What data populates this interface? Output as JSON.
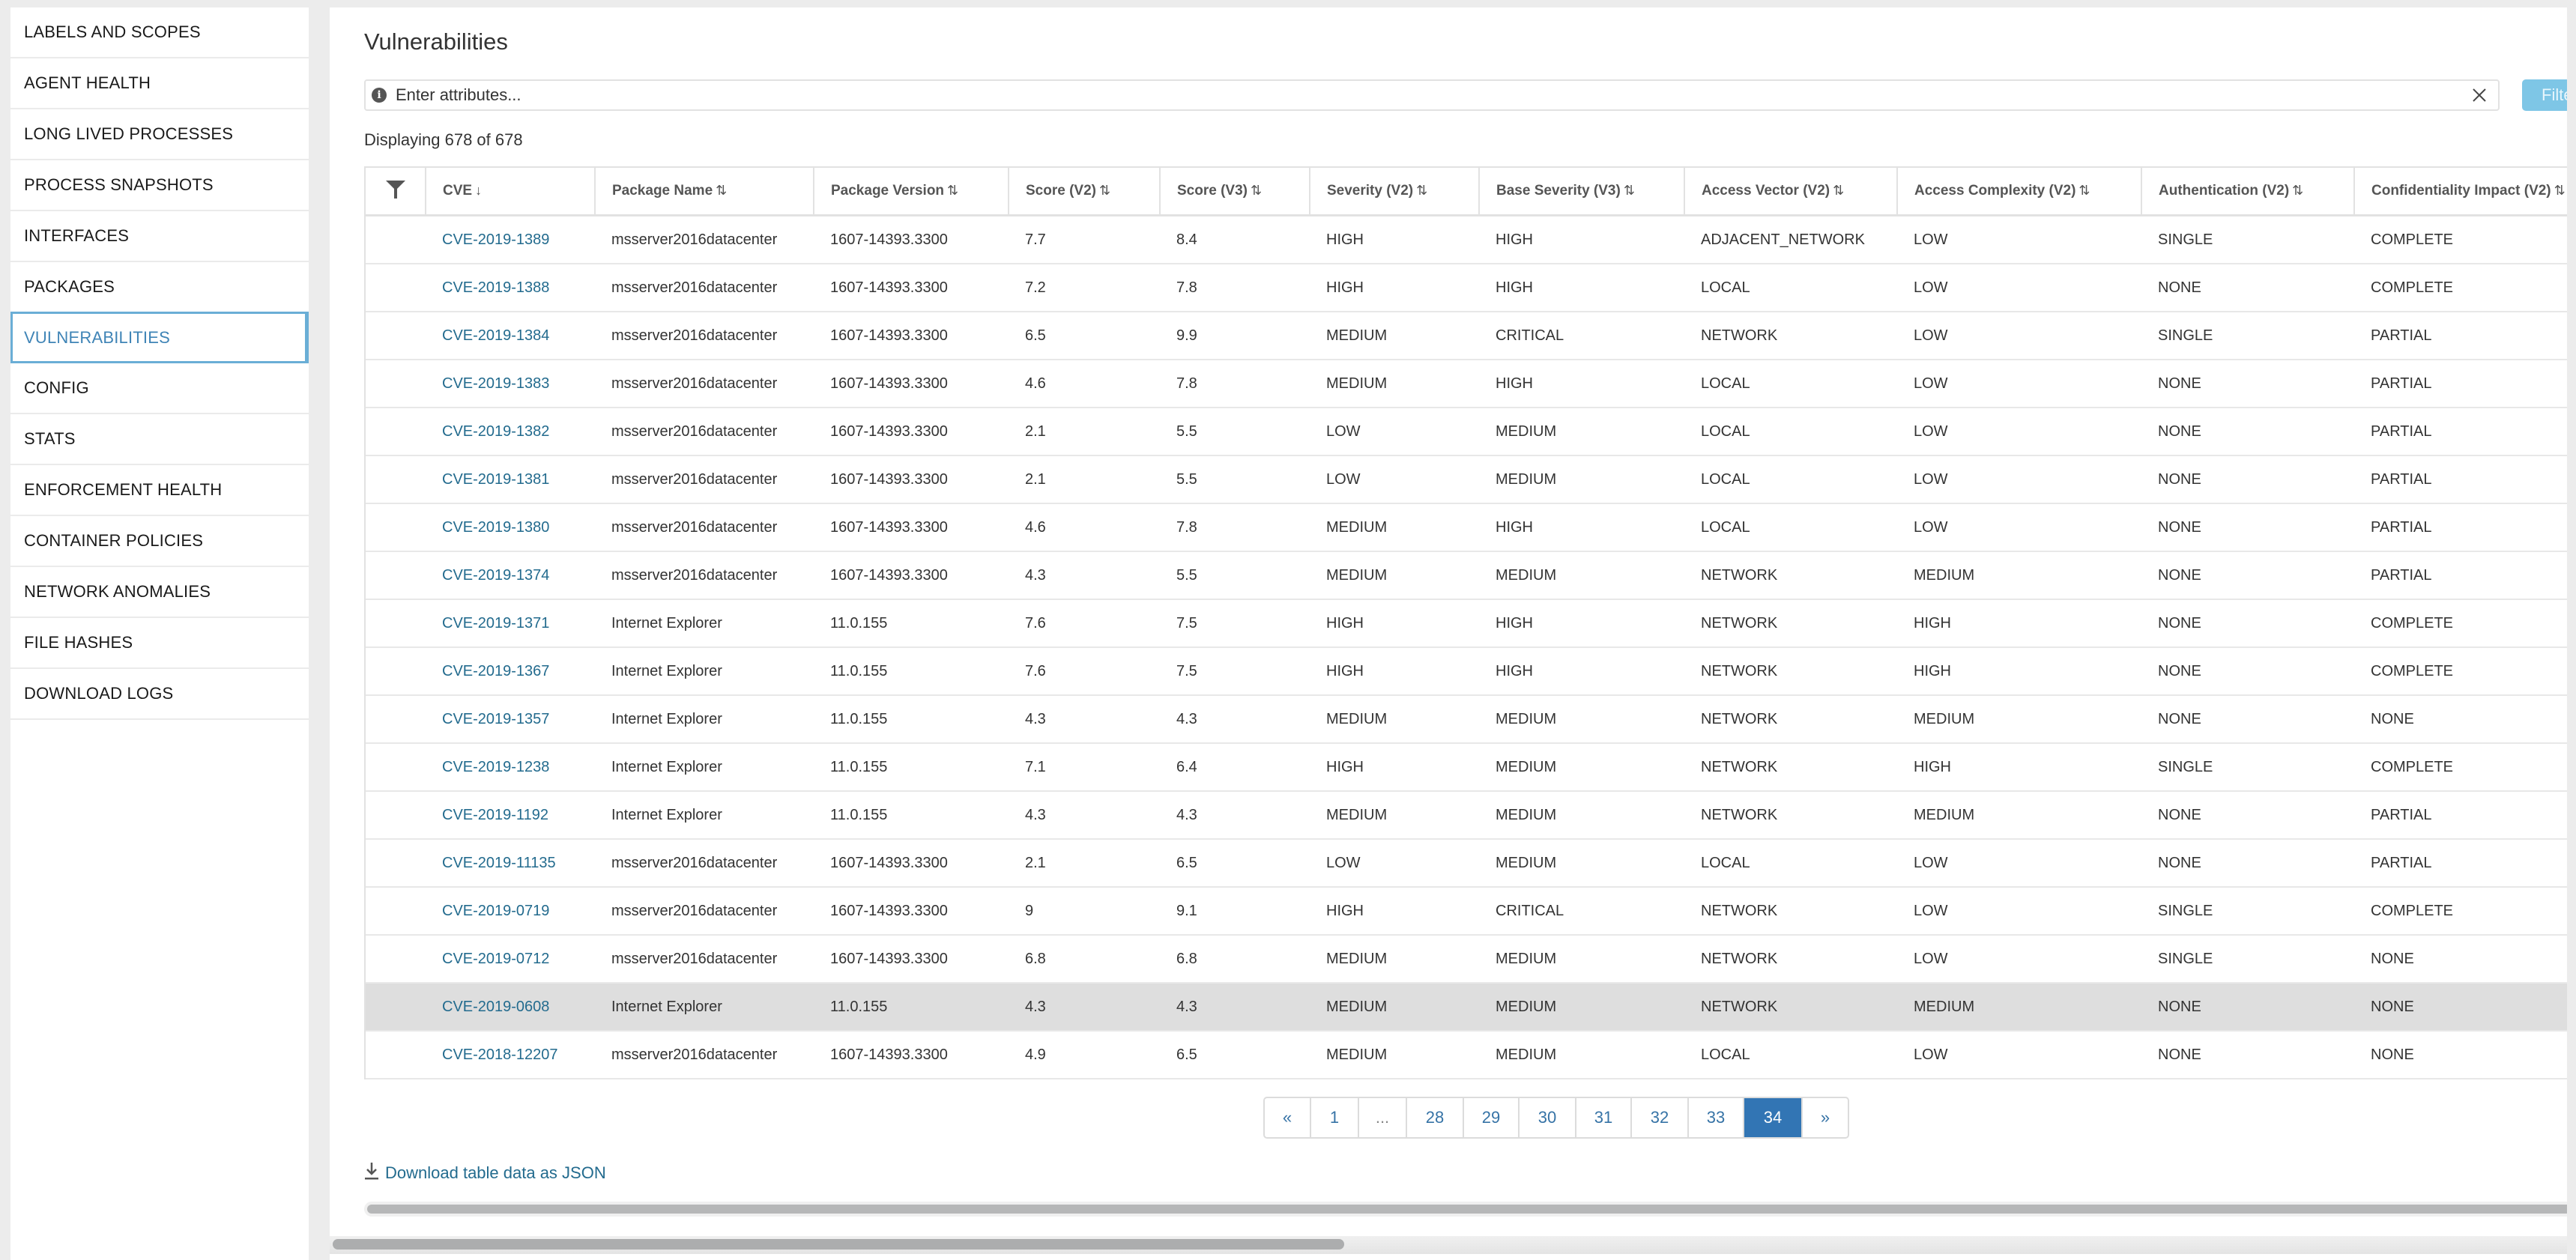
{
  "sidebar": {
    "items": [
      {
        "label": "LABELS AND SCOPES",
        "active": false
      },
      {
        "label": "AGENT HEALTH",
        "active": false
      },
      {
        "label": "LONG LIVED PROCESSES",
        "active": false
      },
      {
        "label": "PROCESS SNAPSHOTS",
        "active": false
      },
      {
        "label": "INTERFACES",
        "active": false
      },
      {
        "label": "PACKAGES",
        "active": false
      },
      {
        "label": "VULNERABILITIES",
        "active": true
      },
      {
        "label": "CONFIG",
        "active": false
      },
      {
        "label": "STATS",
        "active": false
      },
      {
        "label": "ENFORCEMENT HEALTH",
        "active": false
      },
      {
        "label": "CONTAINER POLICIES",
        "active": false
      },
      {
        "label": "NETWORK ANOMALIES",
        "active": false
      },
      {
        "label": "FILE HASHES",
        "active": false
      },
      {
        "label": "DOWNLOAD LOGS",
        "active": false
      }
    ]
  },
  "main": {
    "title": "Vulnerabilities",
    "filter": {
      "placeholder": "Enter attributes...",
      "value": "",
      "info_icon": "info-icon",
      "clear_icon": "close-icon",
      "button_label": "Filter"
    },
    "count_text": "Displaying 678 of 678"
  },
  "table": {
    "filter_icon": "funnel-icon",
    "columns": [
      {
        "label": "CVE",
        "sort": "↓"
      },
      {
        "label": "Package Name",
        "sort": "⇅"
      },
      {
        "label": "Package Version",
        "sort": "⇅"
      },
      {
        "label": "Score (V2)",
        "sort": "⇅"
      },
      {
        "label": "Score (V3)",
        "sort": "⇅"
      },
      {
        "label": "Severity (V2)",
        "sort": "⇅"
      },
      {
        "label": "Base Severity (V3)",
        "sort": "⇅"
      },
      {
        "label": "Access Vector (V2)",
        "sort": "⇅"
      },
      {
        "label": "Access Complexity (V2)",
        "sort": "⇅"
      },
      {
        "label": "Authentication (V2)",
        "sort": "⇅"
      },
      {
        "label": "Confidentiality Impact (V2)",
        "sort": "⇅"
      }
    ],
    "rows": [
      [
        "CVE-2019-1389",
        "msserver2016datacenter",
        "1607-14393.3300",
        "7.7",
        "8.4",
        "HIGH",
        "HIGH",
        "ADJACENT_NETWORK",
        "LOW",
        "SINGLE",
        "COMPLETE"
      ],
      [
        "CVE-2019-1388",
        "msserver2016datacenter",
        "1607-14393.3300",
        "7.2",
        "7.8",
        "HIGH",
        "HIGH",
        "LOCAL",
        "LOW",
        "NONE",
        "COMPLETE"
      ],
      [
        "CVE-2019-1384",
        "msserver2016datacenter",
        "1607-14393.3300",
        "6.5",
        "9.9",
        "MEDIUM",
        "CRITICAL",
        "NETWORK",
        "LOW",
        "SINGLE",
        "PARTIAL"
      ],
      [
        "CVE-2019-1383",
        "msserver2016datacenter",
        "1607-14393.3300",
        "4.6",
        "7.8",
        "MEDIUM",
        "HIGH",
        "LOCAL",
        "LOW",
        "NONE",
        "PARTIAL"
      ],
      [
        "CVE-2019-1382",
        "msserver2016datacenter",
        "1607-14393.3300",
        "2.1",
        "5.5",
        "LOW",
        "MEDIUM",
        "LOCAL",
        "LOW",
        "NONE",
        "PARTIAL"
      ],
      [
        "CVE-2019-1381",
        "msserver2016datacenter",
        "1607-14393.3300",
        "2.1",
        "5.5",
        "LOW",
        "MEDIUM",
        "LOCAL",
        "LOW",
        "NONE",
        "PARTIAL"
      ],
      [
        "CVE-2019-1380",
        "msserver2016datacenter",
        "1607-14393.3300",
        "4.6",
        "7.8",
        "MEDIUM",
        "HIGH",
        "LOCAL",
        "LOW",
        "NONE",
        "PARTIAL"
      ],
      [
        "CVE-2019-1374",
        "msserver2016datacenter",
        "1607-14393.3300",
        "4.3",
        "5.5",
        "MEDIUM",
        "MEDIUM",
        "NETWORK",
        "MEDIUM",
        "NONE",
        "PARTIAL"
      ],
      [
        "CVE-2019-1371",
        "Internet Explorer",
        "11.0.155",
        "7.6",
        "7.5",
        "HIGH",
        "HIGH",
        "NETWORK",
        "HIGH",
        "NONE",
        "COMPLETE"
      ],
      [
        "CVE-2019-1367",
        "Internet Explorer",
        "11.0.155",
        "7.6",
        "7.5",
        "HIGH",
        "HIGH",
        "NETWORK",
        "HIGH",
        "NONE",
        "COMPLETE"
      ],
      [
        "CVE-2019-1357",
        "Internet Explorer",
        "11.0.155",
        "4.3",
        "4.3",
        "MEDIUM",
        "MEDIUM",
        "NETWORK",
        "MEDIUM",
        "NONE",
        "NONE"
      ],
      [
        "CVE-2019-1238",
        "Internet Explorer",
        "11.0.155",
        "7.1",
        "6.4",
        "HIGH",
        "MEDIUM",
        "NETWORK",
        "HIGH",
        "SINGLE",
        "COMPLETE"
      ],
      [
        "CVE-2019-1192",
        "Internet Explorer",
        "11.0.155",
        "4.3",
        "4.3",
        "MEDIUM",
        "MEDIUM",
        "NETWORK",
        "MEDIUM",
        "NONE",
        "PARTIAL"
      ],
      [
        "CVE-2019-11135",
        "msserver2016datacenter",
        "1607-14393.3300",
        "2.1",
        "6.5",
        "LOW",
        "MEDIUM",
        "LOCAL",
        "LOW",
        "NONE",
        "PARTIAL"
      ],
      [
        "CVE-2019-0719",
        "msserver2016datacenter",
        "1607-14393.3300",
        "9",
        "9.1",
        "HIGH",
        "CRITICAL",
        "NETWORK",
        "LOW",
        "SINGLE",
        "COMPLETE"
      ],
      [
        "CVE-2019-0712",
        "msserver2016datacenter",
        "1607-14393.3300",
        "6.8",
        "6.8",
        "MEDIUM",
        "MEDIUM",
        "NETWORK",
        "LOW",
        "SINGLE",
        "NONE"
      ],
      [
        "CVE-2019-0608",
        "Internet Explorer",
        "11.0.155",
        "4.3",
        "4.3",
        "MEDIUM",
        "MEDIUM",
        "NETWORK",
        "MEDIUM",
        "NONE",
        "NONE"
      ],
      [
        "CVE-2018-12207",
        "msserver2016datacenter",
        "1607-14393.3300",
        "4.9",
        "6.5",
        "MEDIUM",
        "MEDIUM",
        "LOCAL",
        "LOW",
        "NONE",
        "NONE"
      ]
    ],
    "highlighted_row_index": 16
  },
  "pagination": {
    "pages": [
      {
        "label": "«",
        "type": "prev"
      },
      {
        "label": "1",
        "type": "page"
      },
      {
        "label": "...",
        "type": "dots"
      },
      {
        "label": "28",
        "type": "page"
      },
      {
        "label": "29",
        "type": "page"
      },
      {
        "label": "30",
        "type": "page"
      },
      {
        "label": "31",
        "type": "page"
      },
      {
        "label": "32",
        "type": "page"
      },
      {
        "label": "33",
        "type": "page"
      },
      {
        "label": "34",
        "type": "page"
      },
      {
        "label": "»",
        "type": "next"
      }
    ],
    "current_page": "34"
  },
  "footer": {
    "download_label": "Download table data as JSON",
    "download_icon": "download-icon"
  },
  "colors": {
    "accent": "#3275b4",
    "link": "#236b8e",
    "active_sidebar": "#3f84b6",
    "filter_button": "#7ec6e6",
    "highlight_row": "#dedede"
  }
}
